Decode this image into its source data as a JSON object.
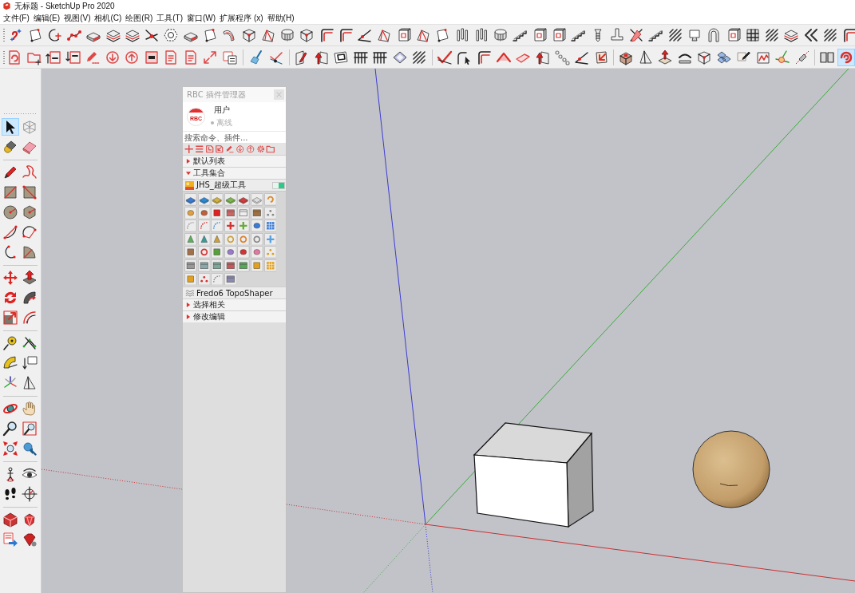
{
  "window": {
    "title": "无标题 - SketchUp Pro 2020"
  },
  "menu": [
    "文件(F)",
    "编辑(E)",
    "视图(V)",
    "相机(C)",
    "绘图(R)",
    "工具(T)",
    "窗口(W)",
    "扩展程序 (x)",
    "帮助(H)"
  ],
  "toolbars": [
    {
      "groups": [
        {
          "buttons": [
            {
              "selected": false
            },
            {
              "selected": false
            },
            {
              "selected": false
            },
            {
              "selected": false
            },
            {
              "selected": false
            },
            {
              "selected": false
            },
            {
              "selected": false
            },
            {
              "selected": false
            },
            {
              "selected": false
            },
            {
              "selected": false
            },
            {
              "selected": false
            },
            {
              "selected": false
            },
            {
              "selected": false
            },
            {
              "selected": false
            },
            {
              "selected": false
            },
            {
              "selected": false
            },
            {
              "selected": false
            },
            {
              "selected": false
            },
            {
              "selected": false
            },
            {
              "selected": false
            },
            {
              "selected": false
            },
            {
              "selected": false
            },
            {
              "selected": false
            },
            {
              "selected": false
            },
            {
              "selected": false
            },
            {
              "selected": false
            },
            {
              "selected": false
            },
            {
              "selected": false
            },
            {
              "selected": false
            },
            {
              "selected": false
            },
            {
              "selected": false
            },
            {
              "selected": false
            },
            {
              "selected": false
            },
            {
              "selected": false
            },
            {
              "selected": false
            },
            {
              "selected": false
            },
            {
              "selected": false
            },
            {
              "selected": false
            },
            {
              "selected": false
            },
            {
              "selected": false
            },
            {
              "selected": false
            },
            {
              "selected": false
            },
            {
              "selected": false
            },
            {
              "selected": false
            }
          ]
        }
      ]
    },
    {
      "groups": [
        {
          "buttons": [
            {
              "selected": false
            },
            {
              "selected": false
            },
            {
              "selected": false
            },
            {
              "selected": false
            },
            {
              "selected": false
            },
            {
              "selected": false
            },
            {
              "selected": false
            },
            {
              "selected": false
            },
            {
              "selected": false
            },
            {
              "selected": false
            },
            {
              "selected": false
            },
            {
              "selected": false
            }
          ]
        },
        {
          "buttons": [
            {
              "selected": false
            },
            {
              "selected": false
            }
          ]
        },
        {
          "buttons": [
            {
              "selected": false
            },
            {
              "selected": false
            },
            {
              "selected": false
            },
            {
              "selected": false
            },
            {
              "selected": false
            },
            {
              "selected": false
            },
            {
              "selected": false
            }
          ]
        },
        {
          "buttons": [
            {
              "selected": false
            },
            {
              "selected": false
            },
            {
              "selected": false
            },
            {
              "selected": false
            },
            {
              "selected": false
            },
            {
              "selected": false
            },
            {
              "selected": false
            },
            {
              "selected": false
            },
            {
              "selected": false
            }
          ]
        },
        {
          "buttons": [
            {
              "selected": false
            },
            {
              "selected": false
            },
            {
              "selected": false
            },
            {
              "selected": false
            },
            {
              "selected": false
            },
            {
              "selected": false
            },
            {
              "selected": false
            },
            {
              "selected": false
            },
            {
              "selected": false
            },
            {
              "selected": false
            }
          ]
        },
        {
          "buttons": [
            {
              "selected": false
            },
            {
              "selected": true
            }
          ]
        }
      ]
    }
  ],
  "left_toolbar": {
    "groups": [
      {
        "tools": [
          {
            "selected": true
          },
          {
            "selected": false
          },
          {
            "selected": false
          },
          {
            "selected": false
          }
        ]
      },
      {
        "tools": [
          {
            "selected": false
          },
          {
            "selected": false
          },
          {
            "selected": false
          },
          {
            "selected": false
          },
          {
            "selected": false
          },
          {
            "selected": false
          },
          {
            "selected": false
          },
          {
            "selected": false
          },
          {
            "selected": false
          },
          {
            "selected": false
          }
        ]
      },
      {
        "tools": [
          {
            "selected": false
          },
          {
            "selected": false
          },
          {
            "selected": false
          },
          {
            "selected": false
          },
          {
            "selected": false
          },
          {
            "selected": false
          }
        ]
      },
      {
        "tools": [
          {
            "selected": false
          },
          {
            "selected": false
          },
          {
            "selected": false
          },
          {
            "selected": false
          },
          {
            "selected": false
          },
          {
            "selected": false
          }
        ]
      },
      {
        "tools": [
          {
            "selected": false
          },
          {
            "selected": false
          },
          {
            "selected": false
          },
          {
            "selected": false
          },
          {
            "selected": false
          },
          {
            "selected": false
          }
        ]
      },
      {
        "tools": [
          {
            "selected": false
          },
          {
            "selected": false
          },
          {
            "selected": false
          },
          {
            "selected": false
          }
        ]
      },
      {
        "tools": [
          {
            "selected": false
          },
          {
            "selected": false
          },
          {
            "selected": false
          },
          {
            "selected": false
          }
        ]
      }
    ]
  },
  "scene": {
    "show_axes": true,
    "objects": [
      {
        "kind": "block"
      },
      {
        "kind": "sphere"
      }
    ]
  },
  "plugin_manager": {
    "title": "RBC 插件管理器",
    "user": {
      "logo_text": "RBC",
      "name": "用户",
      "status": "离线",
      "online": false
    },
    "search": {
      "placeholder": "搜索命令、插件..."
    },
    "sections": [
      {
        "label": "默认列表",
        "expanded": false
      },
      {
        "label": "工具集合",
        "expanded": true,
        "children": [
          {
            "label": "JHS_超级工具",
            "kind": "switchable",
            "on": true,
            "expanded": true
          },
          {
            "label": "Fredo6 TopoShaper",
            "kind": "plain",
            "expanded": false
          }
        ]
      },
      {
        "label": "选择相关",
        "expanded": false
      },
      {
        "label": "修改编辑",
        "expanded": false
      }
    ]
  }
}
